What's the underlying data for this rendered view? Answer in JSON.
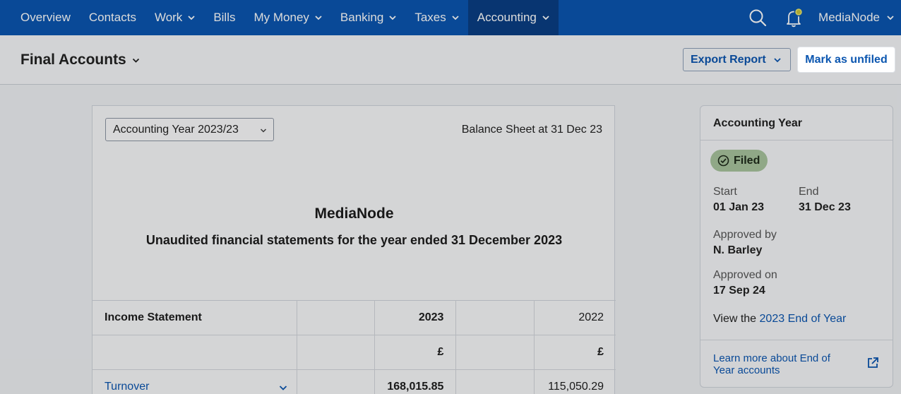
{
  "nav": {
    "items": [
      {
        "label": "Overview",
        "has_menu": false
      },
      {
        "label": "Contacts",
        "has_menu": false
      },
      {
        "label": "Work",
        "has_menu": true
      },
      {
        "label": "Bills",
        "has_menu": false
      },
      {
        "label": "My Money",
        "has_menu": true
      },
      {
        "label": "Banking",
        "has_menu": true
      },
      {
        "label": "Taxes",
        "has_menu": true
      },
      {
        "label": "Accounting",
        "has_menu": true,
        "active": true
      }
    ],
    "search_icon": "search-icon",
    "notification_icon": "bell-icon",
    "user_label": "MediaNode"
  },
  "header": {
    "title": "Final Accounts",
    "export_label": "Export Report",
    "unfile_label": "Mark as unfiled"
  },
  "report": {
    "year_select_value": "Accounting Year 2023/23",
    "caption": "Balance Sheet at 31 Dec 23",
    "company": "MediaNode",
    "subtitle": "Unaudited financial statements for the year ended 31 December 2023",
    "table": {
      "header": {
        "label": "Income Statement",
        "col1": "2023",
        "col2": "2022"
      },
      "currency": {
        "col1": "£",
        "col2": "£"
      },
      "rows": [
        {
          "label": "Turnover",
          "col1": "168,015.85",
          "col2": "115,050.29"
        }
      ]
    }
  },
  "panel": {
    "title": "Accounting Year",
    "status": "Filed",
    "start_label": "Start",
    "start_value": "01 Jan 23",
    "end_label": "End",
    "end_value": "31 Dec 23",
    "approved_by_label": "Approved by",
    "approved_by_value": "N. Barley",
    "approved_on_label": "Approved on",
    "approved_on_value": "17 Sep 24",
    "view_prefix": "View the ",
    "view_link": "2023 End of Year",
    "learn_more": "Learn more about End of Year accounts"
  },
  "colors": {
    "nav_bg": "#0b56b0",
    "nav_active": "#0a3e84",
    "link": "#0b56b0",
    "filed_badge": "#a8c49e"
  }
}
